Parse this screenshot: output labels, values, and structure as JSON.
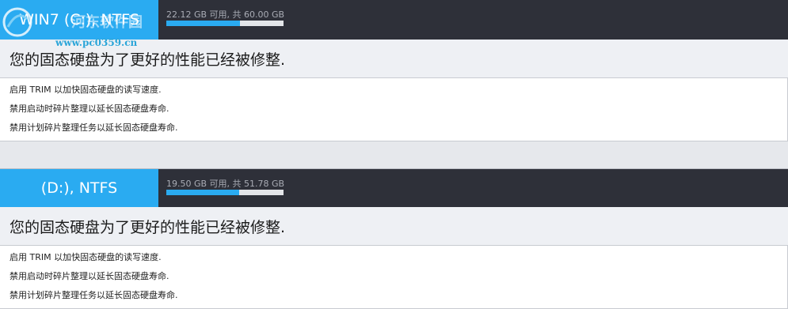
{
  "drives": [
    {
      "label": "WIN7 (C:), NTFS",
      "capacity_text": "22.12 GB 可用, 共 60.00 GB",
      "used_fraction": 0.63,
      "status": "您的固态硬盘为了更好的性能已经被修整.",
      "details": [
        "启用 TRIM 以加快固态硬盘的读写速度.",
        "禁用启动时碎片整理以延长固态硬盘寿命.",
        "禁用计划碎片整理任务以延长固态硬盘寿命."
      ]
    },
    {
      "label": "(D:), NTFS",
      "capacity_text": "19.50 GB 可用, 共 51.78 GB",
      "used_fraction": 0.62,
      "status": "您的固态硬盘为了更好的性能已经被修整.",
      "details": [
        "启用 TRIM 以加快固态硬盘的读写速度.",
        "禁用启动时碎片整理以延长固态硬盘寿命.",
        "禁用计划碎片整理任务以延长固态硬盘寿命."
      ]
    }
  ],
  "watermark": {
    "url": "www.pc0359.cn",
    "text": "河东软件园"
  },
  "colors": {
    "accent": "#2aabf1",
    "header_dark": "#2e3039"
  }
}
